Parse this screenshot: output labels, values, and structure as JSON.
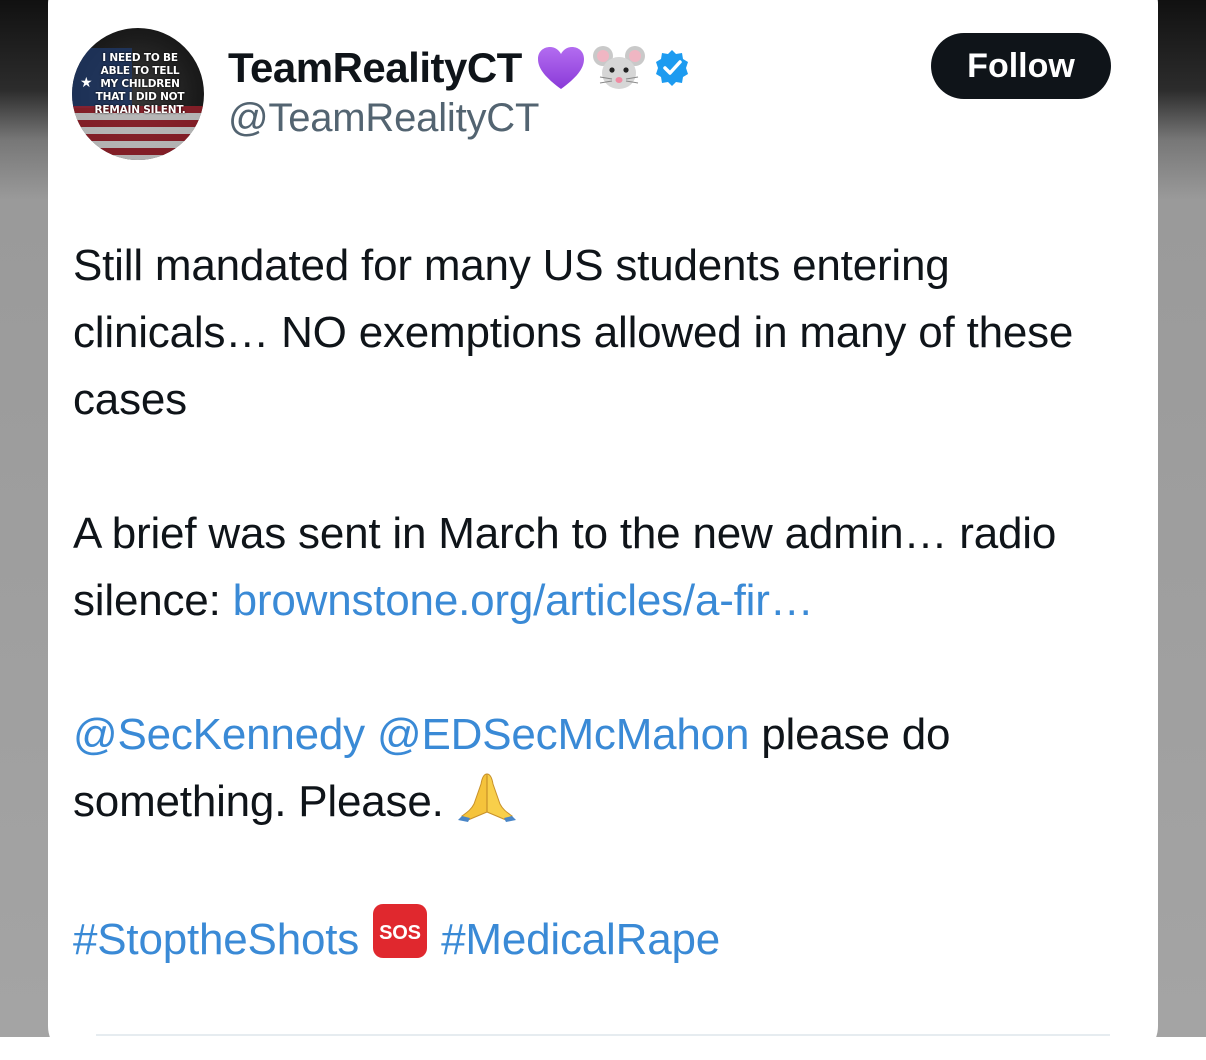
{
  "colors": {
    "text_primary": "#0f1419",
    "text_secondary": "#536471",
    "link": "#3a8ad6",
    "follow_bg": "#0f1419",
    "verified": "#1d9bf0",
    "heart": "#a050e8",
    "sos": "#e0282e"
  },
  "avatar": {
    "text": "I NEED TO BE\nABLE TO TELL\nMY CHILDREN\nTHAT I DID NOT\nREMAIN SILENT.",
    "icon": "flag-avatar"
  },
  "author": {
    "display_name": "TeamRealityCT",
    "handle": "@TeamRealityCT",
    "name_emojis": [
      "purple-heart-icon",
      "mouse-face-icon"
    ],
    "verified_icon": "verified-badge-icon"
  },
  "follow_button": {
    "label": "Follow"
  },
  "tweet": {
    "paragraph1": "Still mandated for many US students entering clinicals… NO exemptions allowed in many of these cases",
    "paragraph2_text": "A brief was sent in March to the new admin… radio silence: ",
    "paragraph2_link": "brownstone.org/articles/a-fir…",
    "mention1": "@SecKennedy",
    "mention2": "@EDSecMcMahon",
    "paragraph3_text": " please do something. Please. ",
    "paragraph3_icon": "folded-hands-icon",
    "hashtag1": "#StoptheShots",
    "sos_icon": "sos-icon",
    "sos_label": "SOS",
    "hashtag2": "#MedicalRape"
  }
}
